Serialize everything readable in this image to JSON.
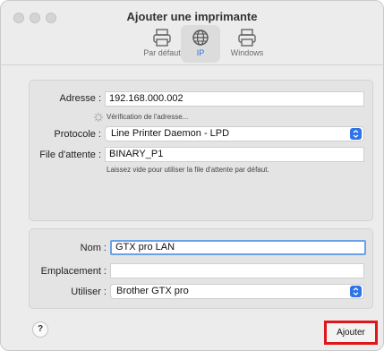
{
  "window": {
    "title": "Ajouter une imprimante"
  },
  "toolbar": {
    "tabs": [
      {
        "label": "Par défaut",
        "icon": "printer-icon",
        "active": false
      },
      {
        "label": "IP",
        "icon": "globe-icon",
        "active": true
      },
      {
        "label": "Windows",
        "icon": "printer-icon",
        "active": false
      }
    ]
  },
  "form": {
    "address": {
      "label": "Adresse :",
      "value": "192.168.000.002"
    },
    "verifying": "Vérification de l'adresse...",
    "protocol": {
      "label": "Protocole :",
      "value": "Line Printer Daemon - LPD"
    },
    "queue": {
      "label": "File d'attente :",
      "value": "BINARY_P1",
      "hint": "Laissez vide pour utiliser la file d'attente par défaut."
    },
    "name": {
      "label": "Nom :",
      "value": "GTX pro LAN"
    },
    "location": {
      "label": "Emplacement :",
      "value": ""
    },
    "use": {
      "label": "Utiliser :",
      "value": "Brother GTX pro"
    }
  },
  "footer": {
    "help": "?",
    "add_button": "Ajouter"
  },
  "colors": {
    "accent": "#2f74e6",
    "highlight": "#e0161b"
  }
}
